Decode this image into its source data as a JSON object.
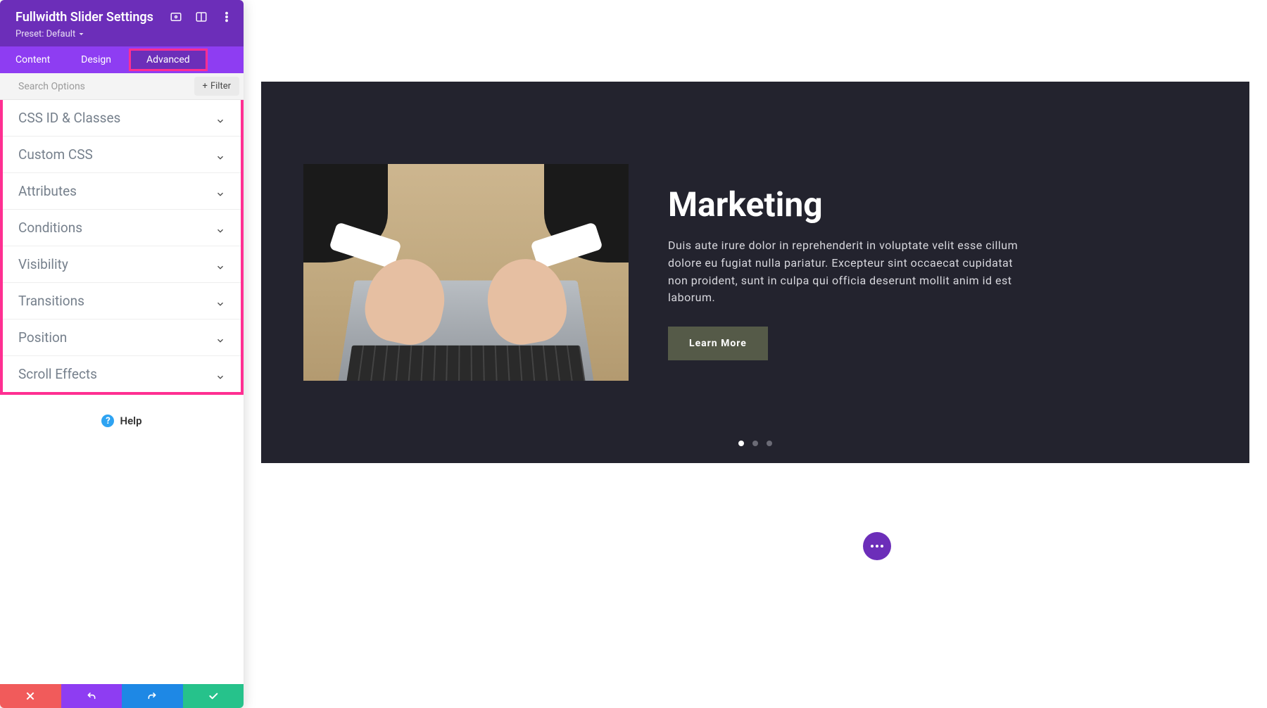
{
  "panel": {
    "title": "Fullwidth Slider Settings",
    "preset_label": "Preset: Default",
    "tabs": {
      "content": "Content",
      "design": "Design",
      "advanced": "Advanced",
      "active": "advanced"
    },
    "search_placeholder": "Search Options",
    "filter_label": "Filter",
    "sections": [
      {
        "id": "css-id-classes",
        "label": "CSS ID & Classes"
      },
      {
        "id": "custom-css",
        "label": "Custom CSS"
      },
      {
        "id": "attributes",
        "label": "Attributes"
      },
      {
        "id": "conditions",
        "label": "Conditions"
      },
      {
        "id": "visibility",
        "label": "Visibility"
      },
      {
        "id": "transitions",
        "label": "Transitions"
      },
      {
        "id": "position",
        "label": "Position"
      },
      {
        "id": "scroll-effects",
        "label": "Scroll Effects"
      }
    ],
    "help_label": "Help"
  },
  "slider": {
    "title": "Marketing",
    "description": "Duis aute irure dolor in reprehenderit in voluptate velit esse cillum dolore eu fugiat nulla pariatur. Excepteur sint occaecat cupidatat non proident, sunt in culpa qui officia deserunt mollit anim id est laborum.",
    "cta_label": "Learn More",
    "slide_count": 3,
    "active_slide_index": 0
  },
  "colors": {
    "brand_purple": "#6c2eb9",
    "tab_purple": "#8e3df2",
    "highlight_pink": "#ff2f92",
    "slider_bg": "#23232e",
    "cta_bg": "#555a48",
    "footer_red": "#f15b5b",
    "footer_blue": "#1e88e5",
    "footer_green": "#26c28b"
  }
}
